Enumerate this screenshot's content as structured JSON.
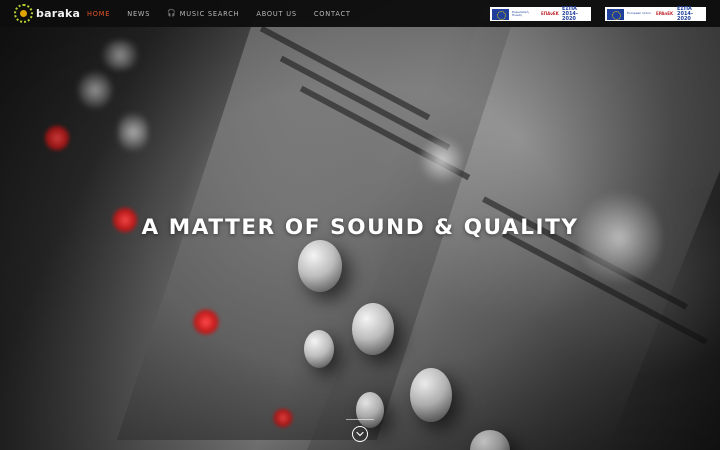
{
  "brand": {
    "name": "baraka"
  },
  "nav": {
    "items": [
      {
        "label": "HOME",
        "active": true
      },
      {
        "label": "NEWS",
        "active": false
      },
      {
        "label": "MUSIC SEARCH",
        "active": false,
        "icon": "headphones-icon"
      },
      {
        "label": "ABOUT US",
        "active": false
      },
      {
        "label": "CONTACT",
        "active": false
      }
    ]
  },
  "banners": [
    {
      "eu_label": "Ευρωπαϊκή Ένωση",
      "sub": "Ευρωπαϊκό Ταμείο Περιφερειακής Ανάπτυξης",
      "program": "ΕΠΑνΕΚ",
      "espa": "ΕΣΠΑ 2014-2020"
    },
    {
      "eu_label": "European Union",
      "sub": "European Regional Development Fund",
      "program": "EPAnEK",
      "espa": "ΕΣΠΑ 2014-2020"
    }
  ],
  "hero": {
    "headline": "A MATTER OF SOUND & QUALITY"
  },
  "colors": {
    "accent": "#e2572b",
    "navbar_bg": "#0e0e0e",
    "nav_text": "#b8b8b8",
    "headline": "#ffffff"
  },
  "icons": {
    "scroll": "chevron-down-icon",
    "logo": "baraka-logo-icon"
  }
}
